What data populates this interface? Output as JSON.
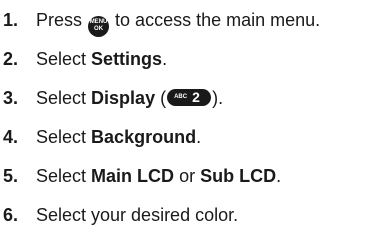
{
  "steps": [
    {
      "number": "1.",
      "prefix": "Press",
      "key_top": "MENU",
      "key_bottom": "OK",
      "suffix": "to access the main menu."
    },
    {
      "number": "2.",
      "prefix": "Select",
      "bold": "Settings",
      "suffix": "."
    },
    {
      "number": "3.",
      "prefix": "Select",
      "bold": "Display",
      "open_paren": "(",
      "key_letters": "ABC",
      "key_number": "2",
      "close_paren": ")."
    },
    {
      "number": "4.",
      "prefix": "Select",
      "bold": "Background",
      "suffix": "."
    },
    {
      "number": "5.",
      "prefix": "Select",
      "bold": "Main LCD",
      "middle": "or",
      "bold2": "Sub LCD",
      "suffix": "."
    },
    {
      "number": "6.",
      "text": "Select your desired color."
    }
  ],
  "colors": {
    "text": "#1a1a1a",
    "key_background": "#1a1a1a",
    "key_text": "#ffffff"
  },
  "icons": {
    "menu_ok_key": "menu-ok-key-icon",
    "abc2_key": "abc-2-key-icon"
  }
}
